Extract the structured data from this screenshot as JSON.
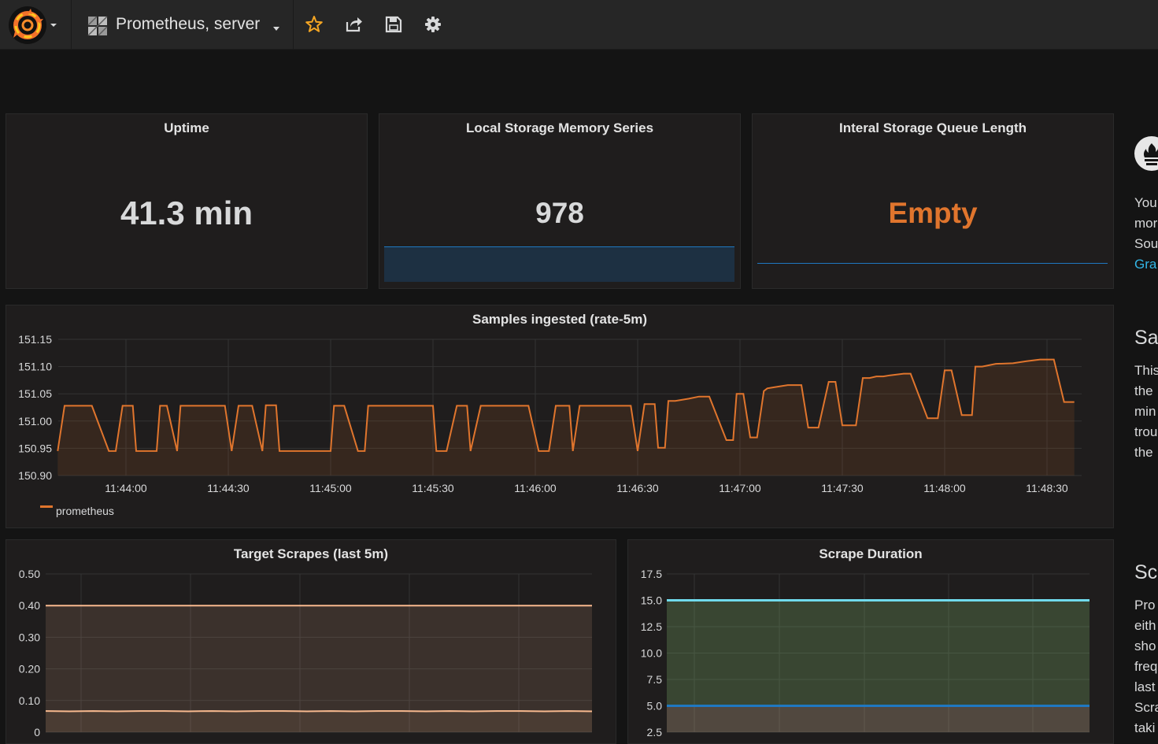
{
  "topbar": {
    "dashboard_title": "Prometheus, server"
  },
  "colors": {
    "orange": "#e0752d",
    "blue": "#1f78c1",
    "peach": "#f9ba8f",
    "teal": "#70dbed"
  },
  "icons": [
    "grafana-logo-icon",
    "dashboard-grid-icon",
    "star-icon",
    "share-icon",
    "save-icon",
    "gear-icon",
    "prometheus-logo-icon"
  ],
  "stats": {
    "uptime": {
      "title": "Uptime",
      "value": "41.3 min"
    },
    "memory_series": {
      "title": "Local Storage Memory Series",
      "value": "978"
    },
    "queue_length": {
      "title": "Interal Storage Queue Length",
      "value": "Empty"
    }
  },
  "samples_panel": {
    "title": "Samples ingested (rate-5m)",
    "legend": "prometheus"
  },
  "scrapes_panel": {
    "title": "Target Scrapes (last 5m)"
  },
  "duration_panel": {
    "title": "Scrape Duration"
  },
  "sidebar": {
    "text1": [
      "You",
      "mor",
      "Sou"
    ],
    "link1": "Gra",
    "heading2": "Sar",
    "text2": [
      "This",
      "the",
      "min",
      "trou",
      "the"
    ],
    "heading3": "Scr",
    "text3": [
      "Pro",
      "eith",
      "sho",
      "freq",
      "last",
      "Scra",
      "taki"
    ]
  },
  "chart_data": [
    {
      "type": "area",
      "title": "Samples ingested (rate-5m)",
      "ylim": [
        150.9,
        151.15
      ],
      "yticks": [
        "151.15",
        "151.10",
        "151.05",
        "151.00",
        "150.95",
        "150.90"
      ],
      "xticks": [
        "11:44:00",
        "11:44:30",
        "11:45:00",
        "11:45:30",
        "11:46:00",
        "11:46:30",
        "11:47:00",
        "11:47:30",
        "11:48:00",
        "11:48:30"
      ],
      "grid": true,
      "legend": "bottom-left",
      "series": [
        {
          "name": "prometheus",
          "x": [
            "11:43:40",
            "11:43:42",
            "11:43:50",
            "11:43:55",
            "11:43:57",
            "11:43:59",
            "11:44:02",
            "11:44:03",
            "11:44:09",
            "11:44:10",
            "11:44:12",
            "11:44:15",
            "11:44:16",
            "11:44:29",
            "11:44:31",
            "11:44:33",
            "11:44:37",
            "11:44:40",
            "11:44:41",
            "11:44:44",
            "11:44:45",
            "11:45:00",
            "11:45:01",
            "11:45:04",
            "11:45:08",
            "11:45:10",
            "11:45:11",
            "11:45:14",
            "11:45:30",
            "11:45:31",
            "11:45:34",
            "11:45:37",
            "11:45:40",
            "11:45:41",
            "11:45:44",
            "11:45:58",
            "11:46:01",
            "11:46:04",
            "11:46:06",
            "11:46:10",
            "11:46:11",
            "11:46:13",
            "11:46:28",
            "11:46:30",
            "11:46:32",
            "11:46:35",
            "11:46:36",
            "11:46:38",
            "11:46:39",
            "11:46:41",
            "11:46:45",
            "11:46:48",
            "11:46:51",
            "11:46:56",
            "11:46:58",
            "11:46:59",
            "11:47:01",
            "11:47:03",
            "11:47:05",
            "11:47:07",
            "11:47:08",
            "11:47:10",
            "11:47:14",
            "11:47:18",
            "11:47:20",
            "11:47:23",
            "11:47:26",
            "11:47:28",
            "11:47:30",
            "11:47:34",
            "11:47:36",
            "11:47:38",
            "11:47:40",
            "11:47:42",
            "11:47:44",
            "11:47:48",
            "11:47:50",
            "11:47:55",
            "11:47:58",
            "11:48:00",
            "11:48:02",
            "11:48:05",
            "11:48:08",
            "11:48:09",
            "11:48:11",
            "11:48:15",
            "11:48:20",
            "11:48:24",
            "11:48:28",
            "11:48:32",
            "11:48:35",
            "11:48:37",
            "11:48:38"
          ],
          "y": [
            150.945,
            151.028,
            151.028,
            150.945,
            150.945,
            151.028,
            151.028,
            150.945,
            150.945,
            151.028,
            151.028,
            150.945,
            151.028,
            151.028,
            150.945,
            151.028,
            151.028,
            150.945,
            151.029,
            151.029,
            150.945,
            150.945,
            151.028,
            151.028,
            150.945,
            150.945,
            151.028,
            151.028,
            151.028,
            150.945,
            150.945,
            151.028,
            151.028,
            150.945,
            151.028,
            151.028,
            150.945,
            150.945,
            151.028,
            151.028,
            150.945,
            151.028,
            151.028,
            150.945,
            151.031,
            151.031,
            150.951,
            150.951,
            151.037,
            151.037,
            151.041,
            151.045,
            151.045,
            150.965,
            150.965,
            151.05,
            151.05,
            150.97,
            150.97,
            151.055,
            151.06,
            151.062,
            151.066,
            151.066,
            150.988,
            150.988,
            151.072,
            151.072,
            150.992,
            150.992,
            151.079,
            151.079,
            151.082,
            151.082,
            151.084,
            151.087,
            151.087,
            151.005,
            151.005,
            151.093,
            151.093,
            151.011,
            151.011,
            151.1,
            151.1,
            151.105,
            151.106,
            151.11,
            151.113,
            151.113,
            151.035,
            151.035,
            151.035
          ]
        }
      ]
    },
    {
      "type": "area",
      "title": "Target Scrapes (last 5m)",
      "ylim": [
        0,
        0.5
      ],
      "yticks": [
        "0.50",
        "0.40",
        "0.30",
        "0.20",
        "0.10",
        "0"
      ],
      "grid": true,
      "series": [
        {
          "values": [
            0.4,
            0.4
          ]
        },
        {
          "values": [
            0.067,
            0.066,
            0.067,
            0.066,
            0.067,
            0.067,
            0.066,
            0.067,
            0.066,
            0.067,
            0.067,
            0.066,
            0.067,
            0.066,
            0.067,
            0.067,
            0.066,
            0.067,
            0.066,
            0.067,
            0.067,
            0.066,
            0.067,
            0.066
          ]
        }
      ]
    },
    {
      "type": "area",
      "title": "Scrape Duration",
      "ylim": [
        2.5,
        17.5
      ],
      "yticks": [
        "17.5",
        "15.0",
        "12.5",
        "10.0",
        "7.5",
        "5.0",
        "2.5"
      ],
      "grid": true,
      "series": [
        {
          "values": [
            15,
            15
          ]
        },
        {
          "values": [
            5,
            5
          ]
        }
      ]
    }
  ]
}
